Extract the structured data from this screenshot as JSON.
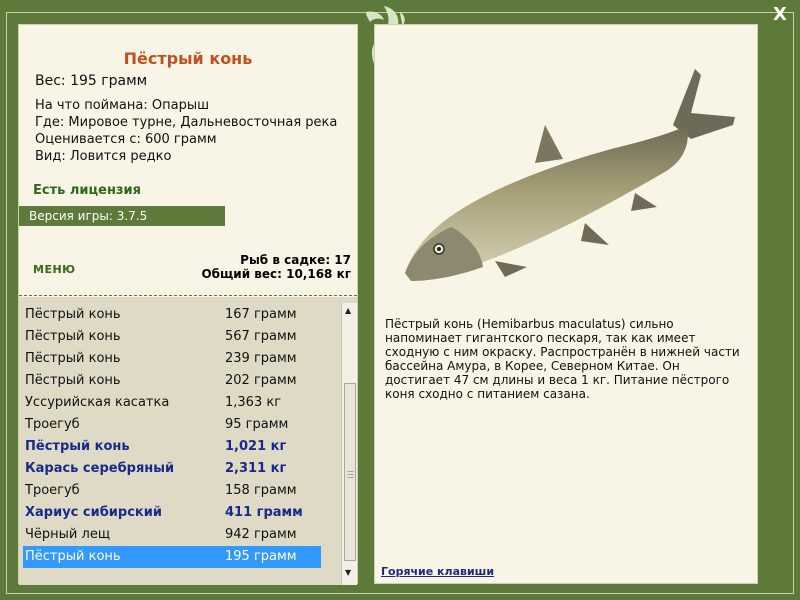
{
  "window": {
    "close_label": "X"
  },
  "fish": {
    "name": "Пёстрый конь",
    "weight": "Вес: 195 грамм",
    "caught_on": "На что поймана: Опарыш",
    "location": "Где: Мировое турне, Дальневосточная река",
    "valued_from": "Оценивается с: 600 грамм",
    "rarity": "Вид: Ловится редко"
  },
  "license": "Есть лицензия",
  "version": "Версия игры: 3.7.5",
  "menu": {
    "label": "МЕНЮ"
  },
  "stats": {
    "fish_in_cage": "Рыб в садке: 17",
    "total_weight": "Общий вес: 10,168 кг"
  },
  "catch_list": [
    {
      "name": "Пёстрый конь",
      "weight": "167 грамм"
    },
    {
      "name": "Пёстрый конь",
      "weight": "567 грамм"
    },
    {
      "name": "Пёстрый конь",
      "weight": "239 грамм"
    },
    {
      "name": "Пёстрый конь",
      "weight": "202 грамм"
    },
    {
      "name": "Уссурийская касатка",
      "weight": "1,363 кг"
    },
    {
      "name": "Троегуб",
      "weight": "95 грамм"
    },
    {
      "name": "Пёстрый конь",
      "weight": "1,021 кг"
    },
    {
      "name": "Карась серебряный",
      "weight": "2,311 кг"
    },
    {
      "name": "Троегуб",
      "weight": "158 грамм"
    },
    {
      "name": "Хариус сибирский",
      "weight": "411 грамм"
    },
    {
      "name": "Чёрный лещ",
      "weight": "942 грамм"
    },
    {
      "name": "Пёстрый конь",
      "weight": "195 грамм"
    }
  ],
  "description": "Пёстрый конь (Hemibarbus maculatus) сильно напоминает гигантского пескаря, так как имеет сходную с ним окраску. Распространён в нижней части бассейна Амура, в Корее, Северном Китае. Он достигает 47 см длины и веса 1 кг. Питание пёстрого коня сходно с питанием сазана.",
  "hotkeys_link": "Горячие клавиши",
  "colors": {
    "frame": "#5e7a3a",
    "panel": "#f8f4e6",
    "title": "#c2501e",
    "highlight_text": "#1a2a8a",
    "selection": "#3399ff",
    "license": "#2b6a1a"
  }
}
